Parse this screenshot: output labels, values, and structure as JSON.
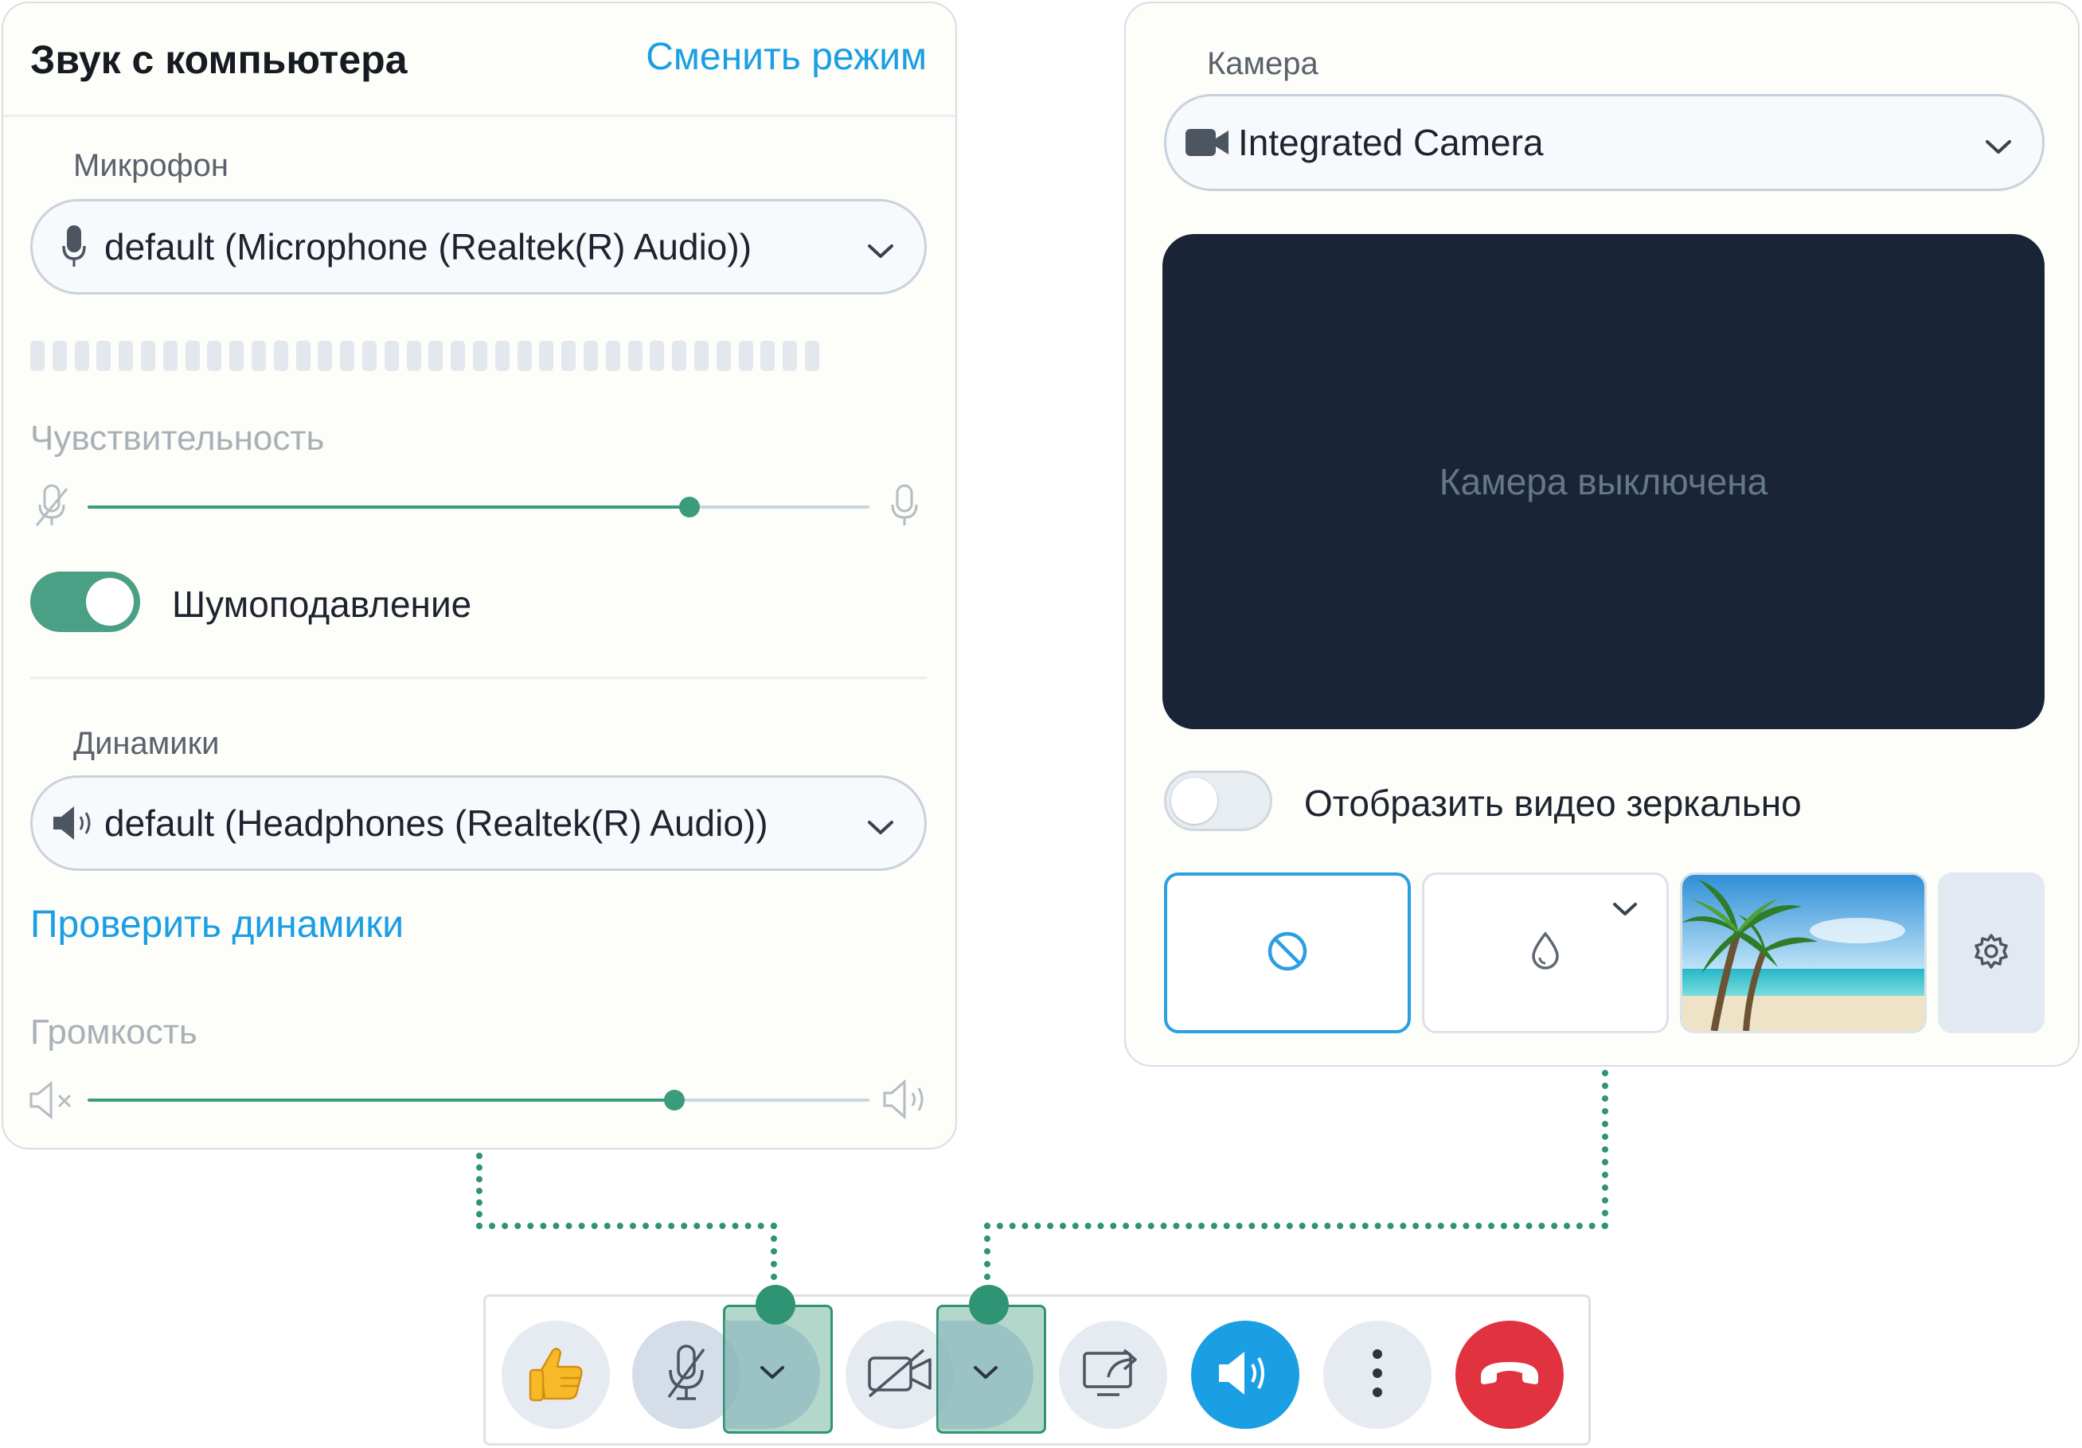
{
  "audio": {
    "title": "Звук с компьютера",
    "switch_mode": "Сменить режим",
    "microphone": {
      "label": "Микрофон",
      "selected": "default (Microphone (Realtek(R) Audio))",
      "icon": "microphone-icon"
    },
    "sensitivity": {
      "label": "Чувствительность",
      "level": 0.77
    },
    "noise_suppression": {
      "label": "Шумоподавление",
      "enabled": true
    },
    "speakers": {
      "label": "Динамики",
      "selected": "default (Headphones (Realtek(R) Audio))",
      "icon": "speaker-icon"
    },
    "test_speakers": "Проверить динамики",
    "volume": {
      "label": "Громкость",
      "level": 0.75
    }
  },
  "video": {
    "camera": {
      "label": "Камера",
      "selected": "Integrated Camera",
      "icon": "video-camera-icon"
    },
    "preview_text": "Камера выключена",
    "mirror": {
      "label": "Отобразить видео зеркально",
      "enabled": false
    },
    "backgrounds": [
      {
        "name": "none",
        "icon": "no-background-icon",
        "selected": true
      },
      {
        "name": "blur",
        "icon": "blur-drop-icon",
        "selected": false
      },
      {
        "name": "beach-image",
        "icon": "beach-palm-image",
        "selected": false
      },
      {
        "name": "settings",
        "icon": "gear-icon",
        "selected": false
      }
    ]
  },
  "toolbar": {
    "buttons": [
      {
        "name": "reactions",
        "icon": "thumbs-up-icon"
      },
      {
        "name": "microphone-muted",
        "icon": "microphone-off-icon"
      },
      {
        "name": "microphone-options",
        "icon": "chevron-down-icon",
        "highlighted": true
      },
      {
        "name": "camera-off",
        "icon": "video-off-icon"
      },
      {
        "name": "camera-options",
        "icon": "chevron-down-icon",
        "highlighted": true
      },
      {
        "name": "share-screen",
        "icon": "screen-share-icon"
      },
      {
        "name": "speaker",
        "icon": "speaker-volume-icon",
        "active": true
      },
      {
        "name": "more",
        "icon": "more-vertical-icon"
      },
      {
        "name": "hang-up",
        "icon": "phone-hangup-icon"
      }
    ]
  },
  "colors": {
    "accent_green": "#2f9473",
    "link_blue": "#1a9ee4",
    "speaker_active": "#1a9ee4",
    "hangup_red": "#e1323f",
    "preview_bg": "#192536"
  }
}
